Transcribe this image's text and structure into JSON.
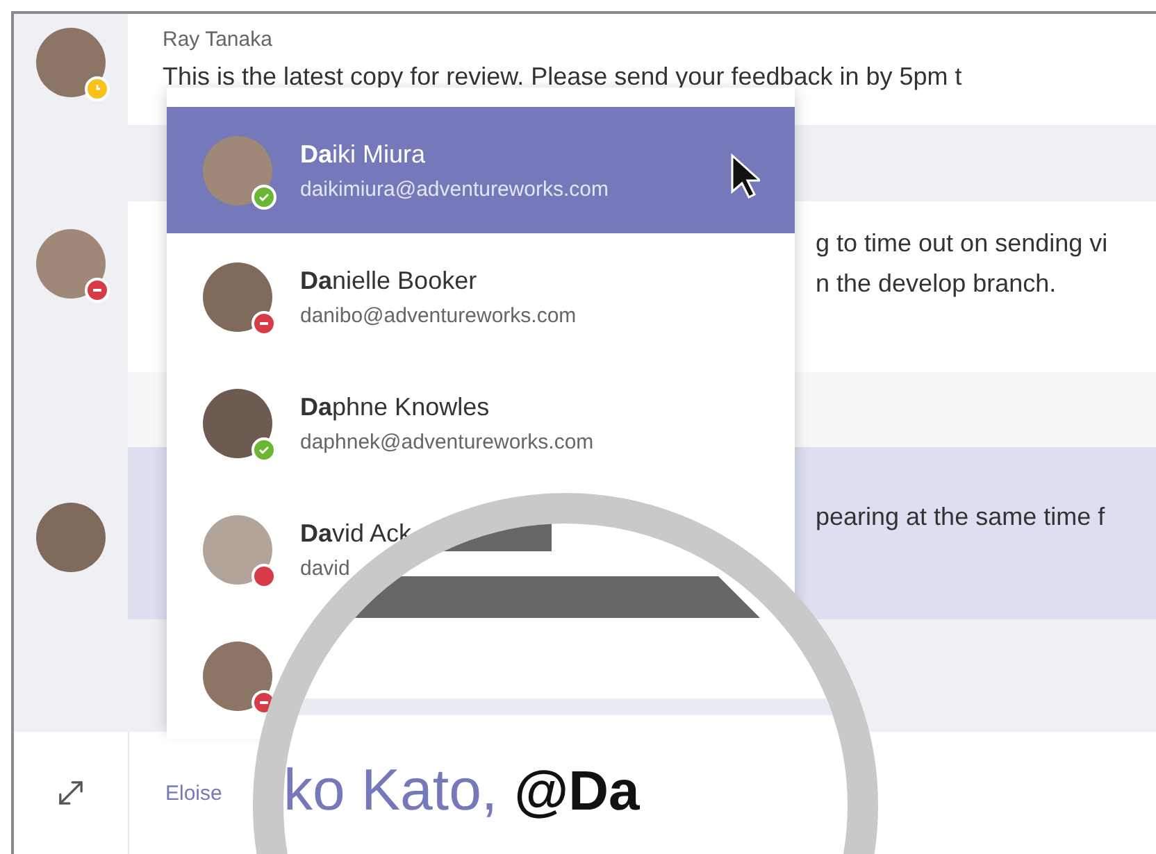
{
  "messages": [
    {
      "author": "Ray Tanaka",
      "lines": [
        "This is the latest copy for review. Please send your feedback in by 5pm t"
      ],
      "presence": {
        "kind": "away",
        "color": "#f8c21b"
      },
      "highlighted": false
    },
    {
      "lines": [
        "g to time out on sending vi",
        "n the develop branch."
      ],
      "presence": {
        "kind": "dnd",
        "color": "#d83b48"
      },
      "highlighted": false
    },
    {
      "lines": [
        "pearing at the same time f"
      ],
      "highlighted": true
    }
  ],
  "mention_list": [
    {
      "name": "**Da**iki Miura",
      "email": "daikimiura@adventureworks.com",
      "presence": {
        "kind": "available",
        "color": "#6bb633"
      },
      "selected": true
    },
    {
      "name": "**Da**nielle Booker",
      "email": "danibo@adventureworks.com",
      "presence": {
        "kind": "dnd",
        "color": "#d83b48"
      },
      "selected": false
    },
    {
      "name": "**Da**phne Knowles",
      "email": "daphnek@adventureworks.com",
      "presence": {
        "kind": "available",
        "color": "#6bb633"
      },
      "selected": false
    },
    {
      "name": "**Da**vid Ack",
      "email": "david",
      "presence": {
        "kind": "busy",
        "color": "#d83b48"
      },
      "selected": false
    },
    {
      "presence": {
        "kind": "dnd",
        "color": "#d83b48"
      },
      "selected": false
    }
  ],
  "compose": {
    "sender": "Eloise",
    "mention": "ko Kato,",
    "typed": "@Da"
  }
}
